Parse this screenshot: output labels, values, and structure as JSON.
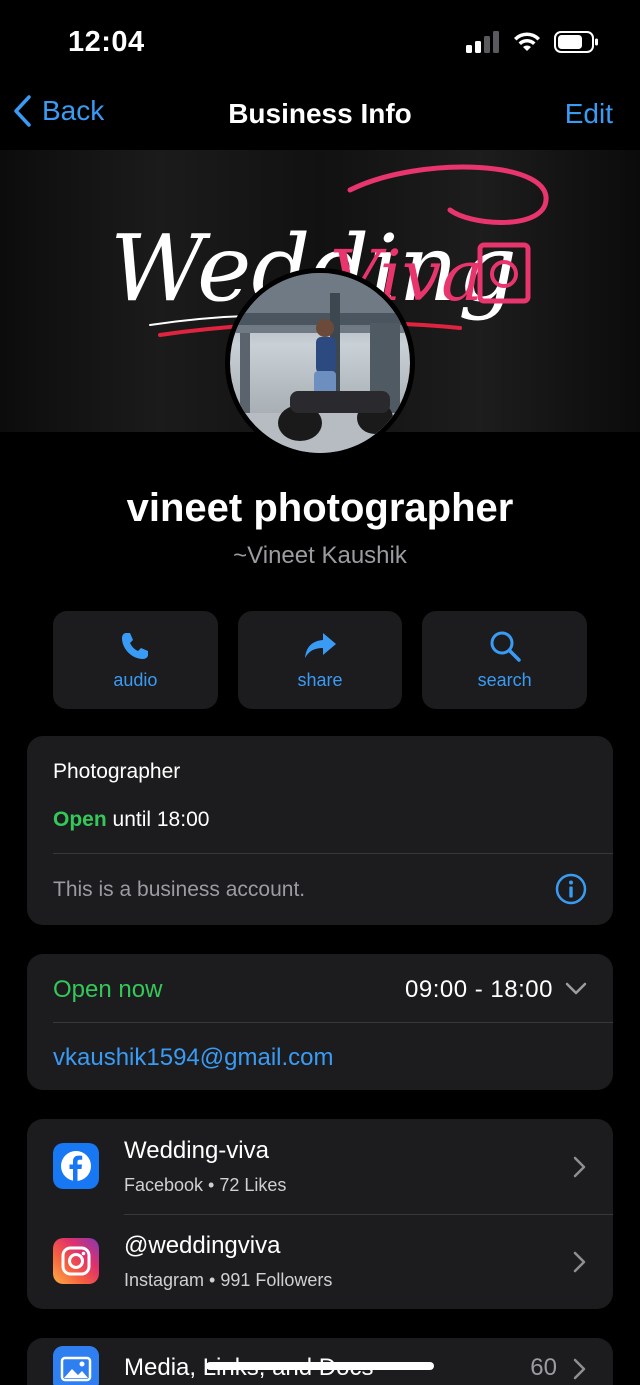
{
  "status_bar": {
    "time": "12:04"
  },
  "nav": {
    "back_label": "Back",
    "title": "Business Info",
    "edit_label": "Edit"
  },
  "cover": {
    "logo_text_1": "Wedding",
    "logo_text_2": "Viva"
  },
  "profile": {
    "name": "vineet photographer",
    "subtitle": "~Vineet Kaushik"
  },
  "actions": [
    {
      "label": "audio",
      "icon": "phone-icon"
    },
    {
      "label": "share",
      "icon": "share-arrow-icon"
    },
    {
      "label": "search",
      "icon": "search-icon"
    }
  ],
  "business": {
    "category": "Photographer",
    "open_label": "Open",
    "open_until": "until 18:00",
    "note": "This is a business account."
  },
  "hours": {
    "status": "Open now",
    "range": "09:00 - 18:00",
    "email": "vkaushik1594@gmail.com"
  },
  "social": [
    {
      "title": "Wedding-viva",
      "subtitle": "Facebook • 72 Likes",
      "icon": "facebook-icon"
    },
    {
      "title": "@weddingviva",
      "subtitle": "Instagram • 991 Followers",
      "icon": "instagram-icon"
    }
  ],
  "media": {
    "label": "Media, Links, and Docs",
    "count": "60"
  },
  "colors": {
    "accent": "#3a9bf5",
    "green": "#34c759",
    "card": "#1c1c1e",
    "brand_pink": "#e8356d"
  }
}
